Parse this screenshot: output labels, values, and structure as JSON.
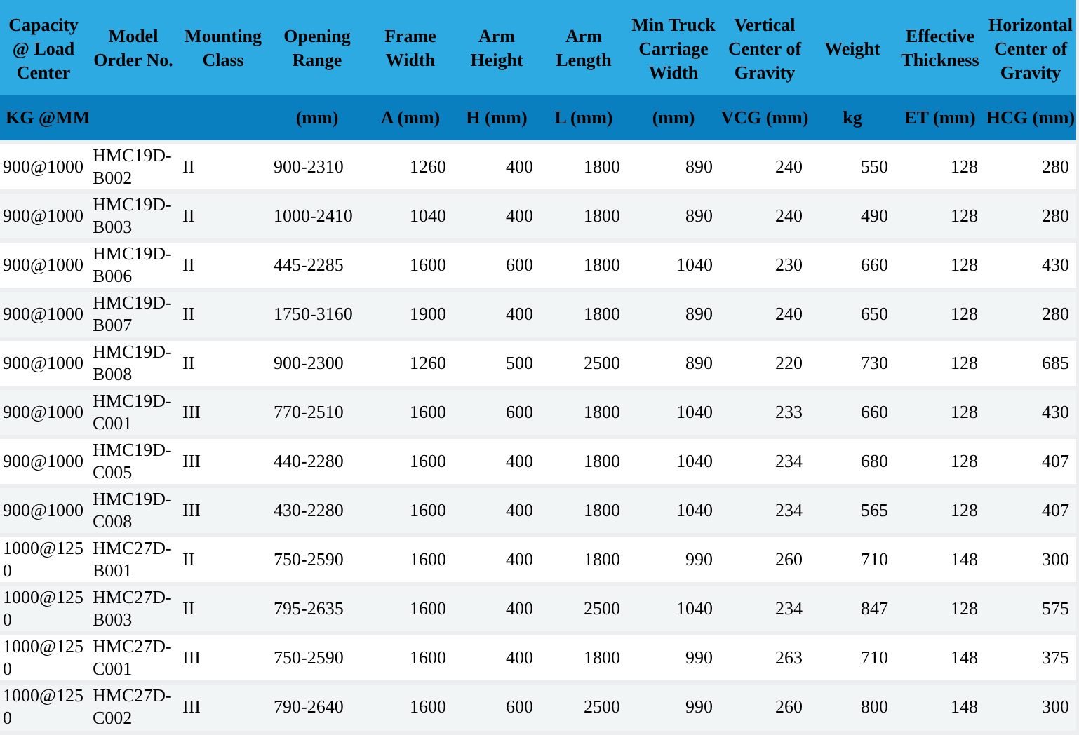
{
  "table": {
    "columns": [
      {
        "label": "Capacity @ Load Center",
        "unit": "KG @MM"
      },
      {
        "label": "Model Order No."
      },
      {
        "label": "Mounting Class"
      },
      {
        "label": "Opening Range",
        "unit": "(mm)"
      },
      {
        "label": "Frame Width",
        "unit": "A (mm)"
      },
      {
        "label": "Arm Height",
        "unit": "H (mm)"
      },
      {
        "label": "Arm Length",
        "unit": "L (mm)"
      },
      {
        "label": "Min Truck Carriage Width",
        "unit": "(mm)"
      },
      {
        "label": "Vertical Center of Gravity",
        "unit": "VCG (mm)"
      },
      {
        "label": "Weight",
        "unit": "kg"
      },
      {
        "label": "Effective Thickness",
        "unit": "ET (mm)"
      },
      {
        "label": "Horizontal Center of Gravity",
        "unit": "HCG (mm)"
      }
    ],
    "rows": [
      [
        "900@1000",
        "HMC19D-B002",
        "II",
        "900-2310",
        "1260",
        "400",
        "1800",
        "890",
        "240",
        "550",
        "128",
        "280"
      ],
      [
        "900@1000",
        "HMC19D-B003",
        "II",
        "1000-2410",
        "1040",
        "400",
        "1800",
        "890",
        "240",
        "490",
        "128",
        "280"
      ],
      [
        "900@1000",
        "HMC19D-B006",
        "II",
        "445-2285",
        "1600",
        "600",
        "1800",
        "1040",
        "230",
        "660",
        "128",
        "430"
      ],
      [
        "900@1000",
        "HMC19D-B007",
        "II",
        "1750-3160",
        "1900",
        "400",
        "1800",
        "890",
        "240",
        "650",
        "128",
        "280"
      ],
      [
        "900@1000",
        "HMC19D-B008",
        "II",
        "900-2300",
        "1260",
        "500",
        "2500",
        "890",
        "220",
        "730",
        "128",
        "685"
      ],
      [
        "900@1000",
        "HMC19D-C001",
        "III",
        "770-2510",
        "1600",
        "600",
        "1800",
        "1040",
        "233",
        "660",
        "128",
        "430"
      ],
      [
        "900@1000",
        "HMC19D-C005",
        "III",
        "440-2280",
        "1600",
        "400",
        "1800",
        "1040",
        "234",
        "680",
        "128",
        "407"
      ],
      [
        "900@1000",
        "HMC19D-C008",
        "III",
        "430-2280",
        "1600",
        "400",
        "1800",
        "1040",
        "234",
        "565",
        "128",
        "407"
      ],
      [
        "1000@1250",
        "HMC27D-B001",
        "II",
        "750-2590",
        "1600",
        "400",
        "1800",
        "990",
        "260",
        "710",
        "148",
        "300"
      ],
      [
        "1000@1250",
        "HMC27D-B003",
        "II",
        "795-2635",
        "1600",
        "400",
        "2500",
        "1040",
        "234",
        "847",
        "128",
        "575"
      ],
      [
        "1000@1250",
        "HMC27D-C001",
        "III",
        "750-2590",
        "1600",
        "400",
        "1800",
        "990",
        "263",
        "710",
        "148",
        "375"
      ],
      [
        "1000@1250",
        "HMC27D-C002",
        "III",
        "790-2640",
        "1600",
        "600",
        "2500",
        "990",
        "260",
        "800",
        "148",
        "300"
      ]
    ]
  }
}
